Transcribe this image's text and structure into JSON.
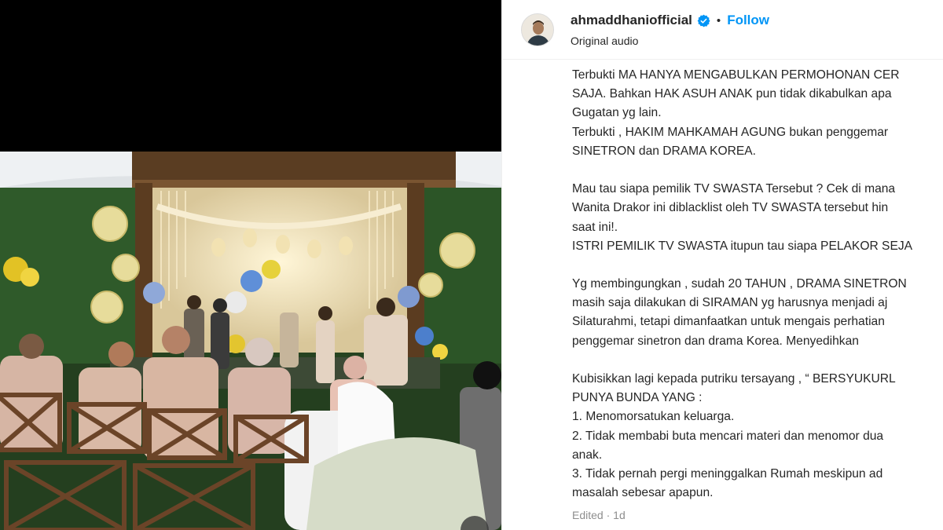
{
  "post": {
    "username": "ahmaddhaniofficial",
    "separator": "•",
    "follow_label": "Follow",
    "audio_label": "Original audio"
  },
  "caption": {
    "lines": [
      "Terbukti MA HANYA MENGABULKAN PERMOHONAN CER",
      "SAJA. Bahkan HAK ASUH ANAK pun tidak dikabulkan apa",
      "Gugatan yg lain.",
      "Terbukti , HAKIM MAHKAMAH AGUNG bukan penggemar",
      "SINETRON dan DRAMA KOREA.",
      "",
      "Mau tau siapa pemilik TV SWASTA Tersebut ? Cek di mana",
      "Wanita Drakor ini diblacklist oleh TV SWASTA tersebut hin",
      "saat ini!.",
      "ISTRI PEMILIK TV SWASTA itupun tau siapa PELAKOR SEJA",
      "",
      "Yg membingungkan , sudah 20 TAHUN , DRAMA SINETRON",
      "masih saja dilakukan di SIRAMAN yg harusnya menjadi aj",
      "Silaturahmi, tetapi dimanfaatkan untuk mengais perhatian",
      "penggemar sinetron dan drama Korea. Menyedihkan",
      "",
      "Kubisikkan lagi kepada putriku tersayang , “ BERSYUKURL",
      "PUNYA BUNDA YANG :",
      "1. Menomorsatukan keluarga.",
      "2. Tidak membabi buta mencari materi dan menomor dua",
      "anak.",
      "3. Tidak pernah pergi meninggalkan Rumah meskipun ad",
      "masalah sebesar apapun."
    ]
  },
  "meta": {
    "edited_label": "Edited",
    "separator": "·",
    "age": "1d"
  },
  "colors": {
    "follow": "#0095f6",
    "verified": "#0095f6",
    "muted": "#8e8e8e",
    "text": "#262626"
  },
  "icons": {
    "verified": "verified-badge-icon",
    "avatar": "profile-avatar"
  }
}
